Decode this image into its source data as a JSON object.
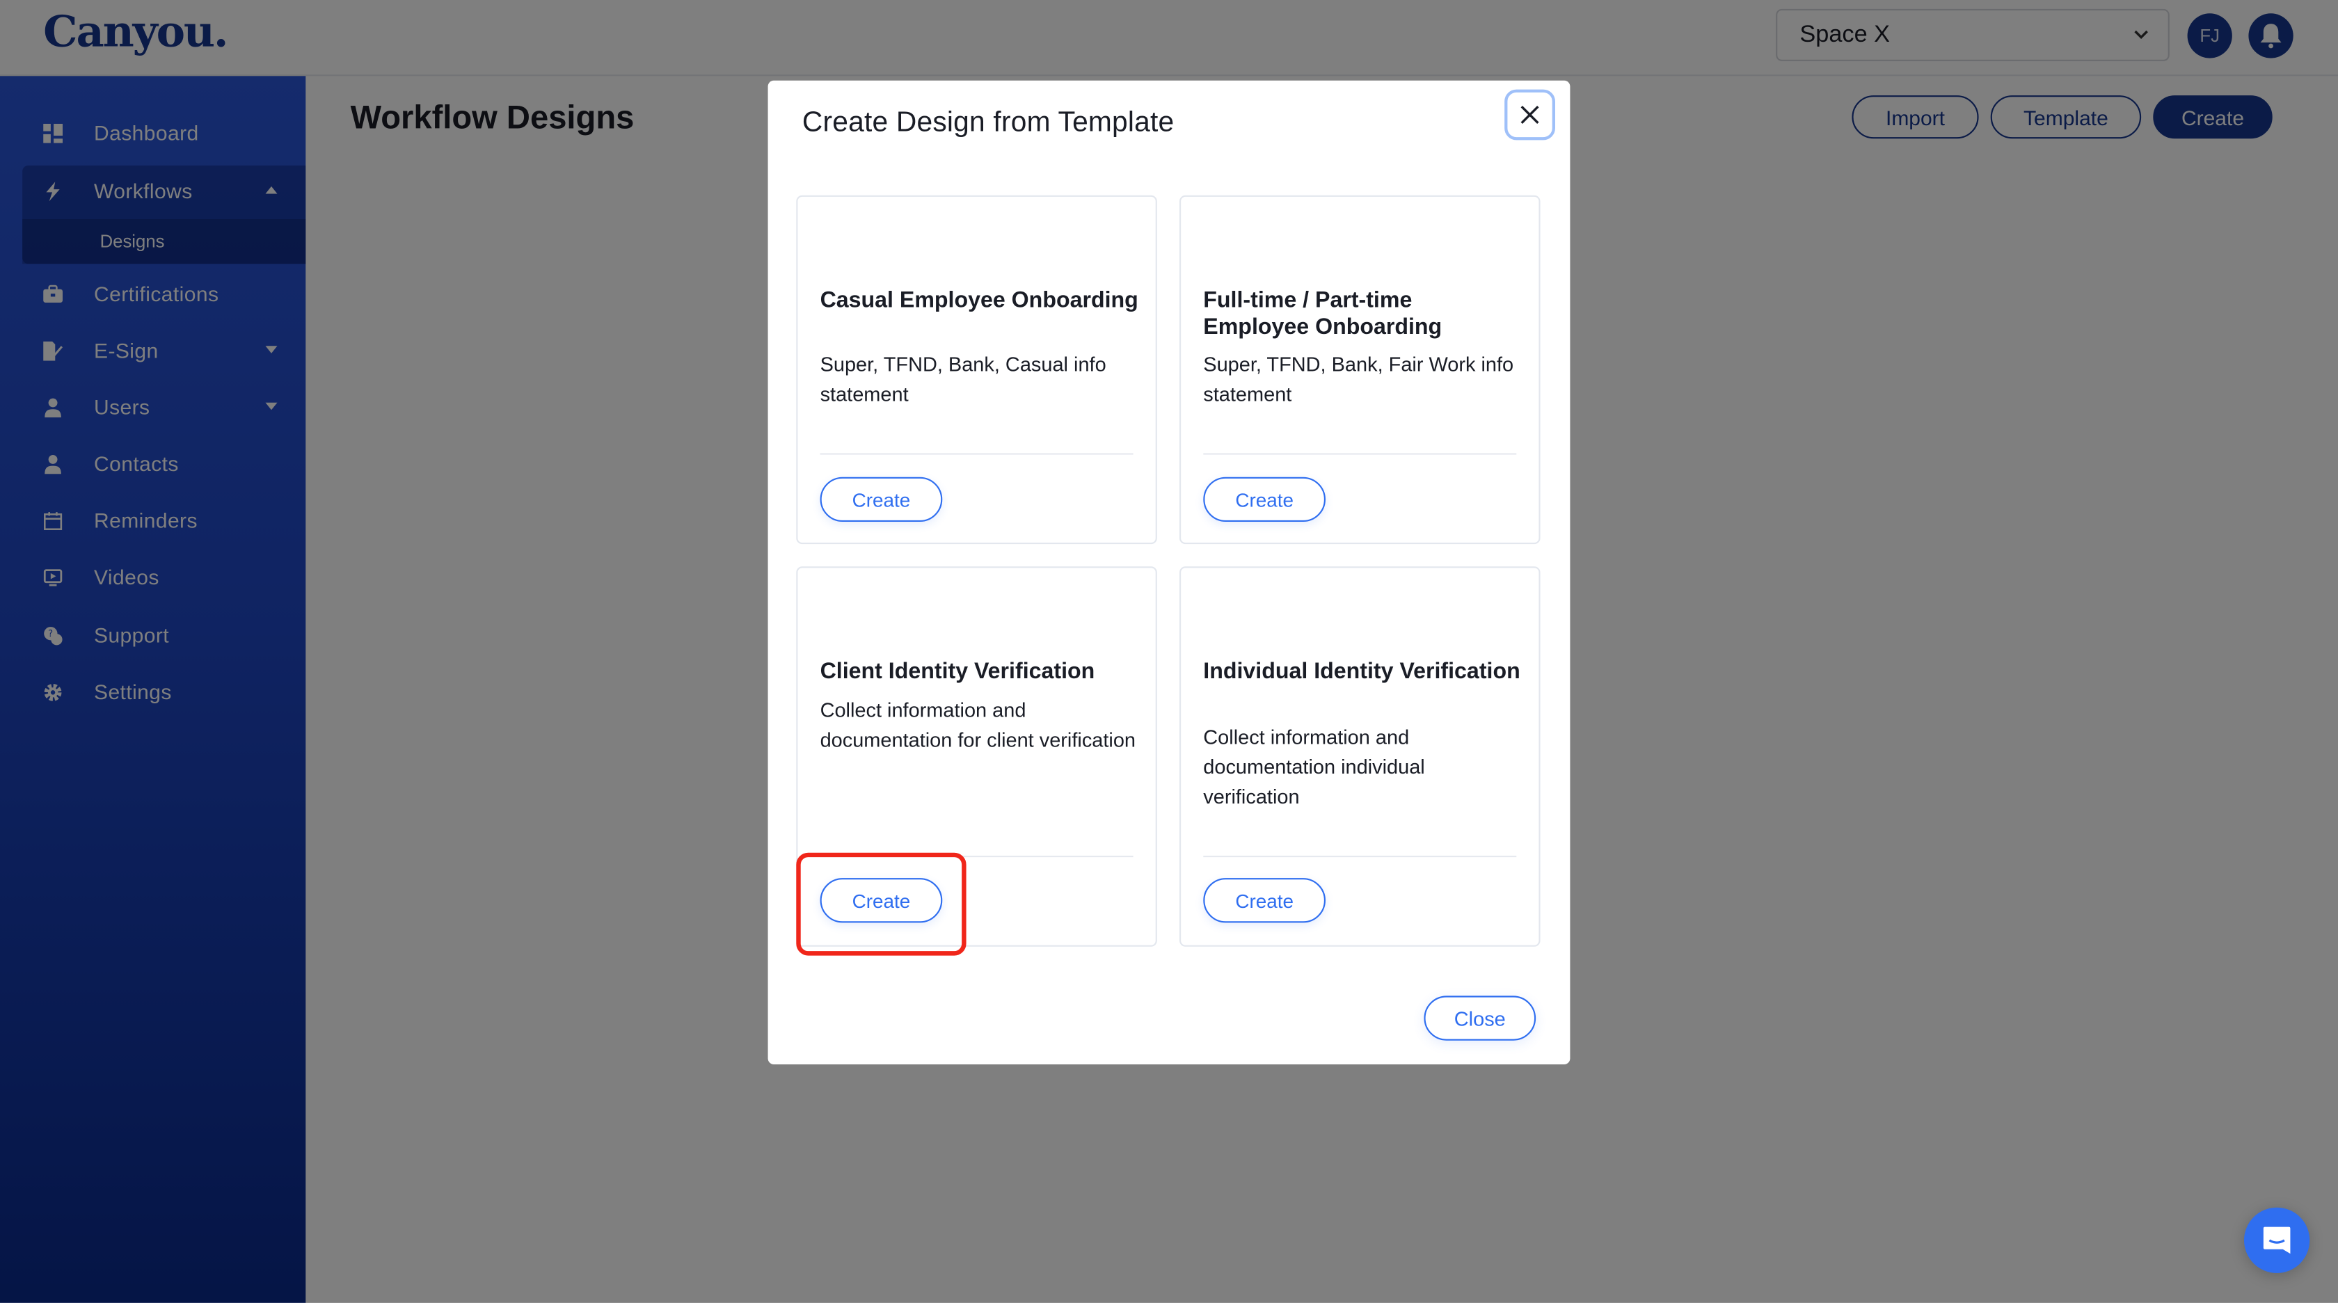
{
  "app": {
    "logo": "Canyou.",
    "workspace_selector": {
      "value": "Space X"
    },
    "avatar_initials": "FJ"
  },
  "sidebar": {
    "items": [
      {
        "label": "Dashboard",
        "icon": "dashboard-icon"
      },
      {
        "label": "Workflows",
        "icon": "bolt-icon",
        "expanded": true,
        "children": [
          {
            "label": "Designs",
            "active": true
          }
        ]
      },
      {
        "label": "Certifications",
        "icon": "briefcase-icon"
      },
      {
        "label": "E-Sign",
        "icon": "document-sign-icon",
        "has_submenu": true
      },
      {
        "label": "Users",
        "icon": "user-icon",
        "has_submenu": true
      },
      {
        "label": "Contacts",
        "icon": "user-icon"
      },
      {
        "label": "Reminders",
        "icon": "calendar-icon"
      },
      {
        "label": "Videos",
        "icon": "video-icon"
      },
      {
        "label": "Support",
        "icon": "support-chat-icon"
      },
      {
        "label": "Settings",
        "icon": "gear-icon"
      }
    ]
  },
  "page": {
    "title": "Workflow Designs",
    "actions": {
      "import": "Import",
      "template": "Template",
      "create": "Create"
    }
  },
  "modal": {
    "title": "Create Design from Template",
    "close_label": "Close",
    "templates": [
      {
        "title": "Casual Employee Onboarding",
        "description": "Super, TFND, Bank, Casual info statement",
        "button": "Create"
      },
      {
        "title": "Full-time / Part-time Employee Onboarding",
        "description": "Super, TFND, Bank, Fair Work info statement",
        "button": "Create"
      },
      {
        "title": "Client Identity Verification",
        "description": "Collect information and documentation for client verification",
        "button": "Create",
        "highlighted": true
      },
      {
        "title": "Individual Identity Verification",
        "description": "Collect information and documentation individual verification",
        "button": "Create"
      }
    ]
  },
  "colors": {
    "brand": "#17378f",
    "accent": "#2f6ef0",
    "highlight": "#f0261a"
  }
}
